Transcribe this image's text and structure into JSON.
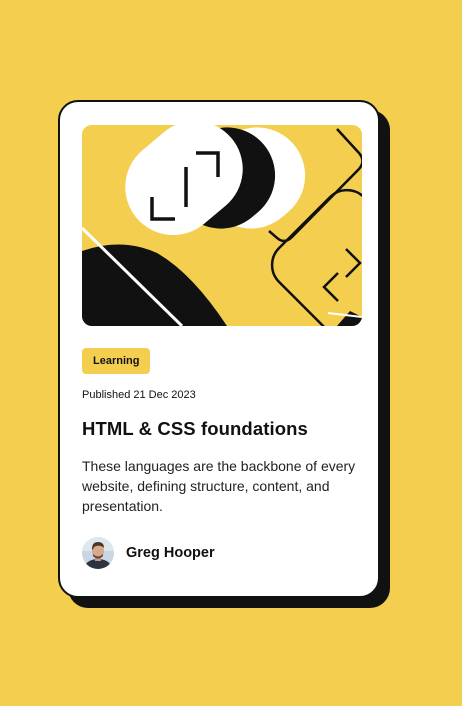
{
  "card": {
    "tag": "Learning",
    "published": "Published 21 Dec 2023",
    "title": "HTML & CSS foundations",
    "description": "These languages are the backbone of every website, defining structure, content, and presentation.",
    "author": {
      "name": "Greg Hooper"
    }
  },
  "colors": {
    "background": "#f4ce4f",
    "card": "#ffffff",
    "ink": "#111111",
    "tag_background": "#f4ce4f"
  },
  "icons": {
    "hero": "abstract-illustration",
    "avatar": "author-portrait"
  }
}
